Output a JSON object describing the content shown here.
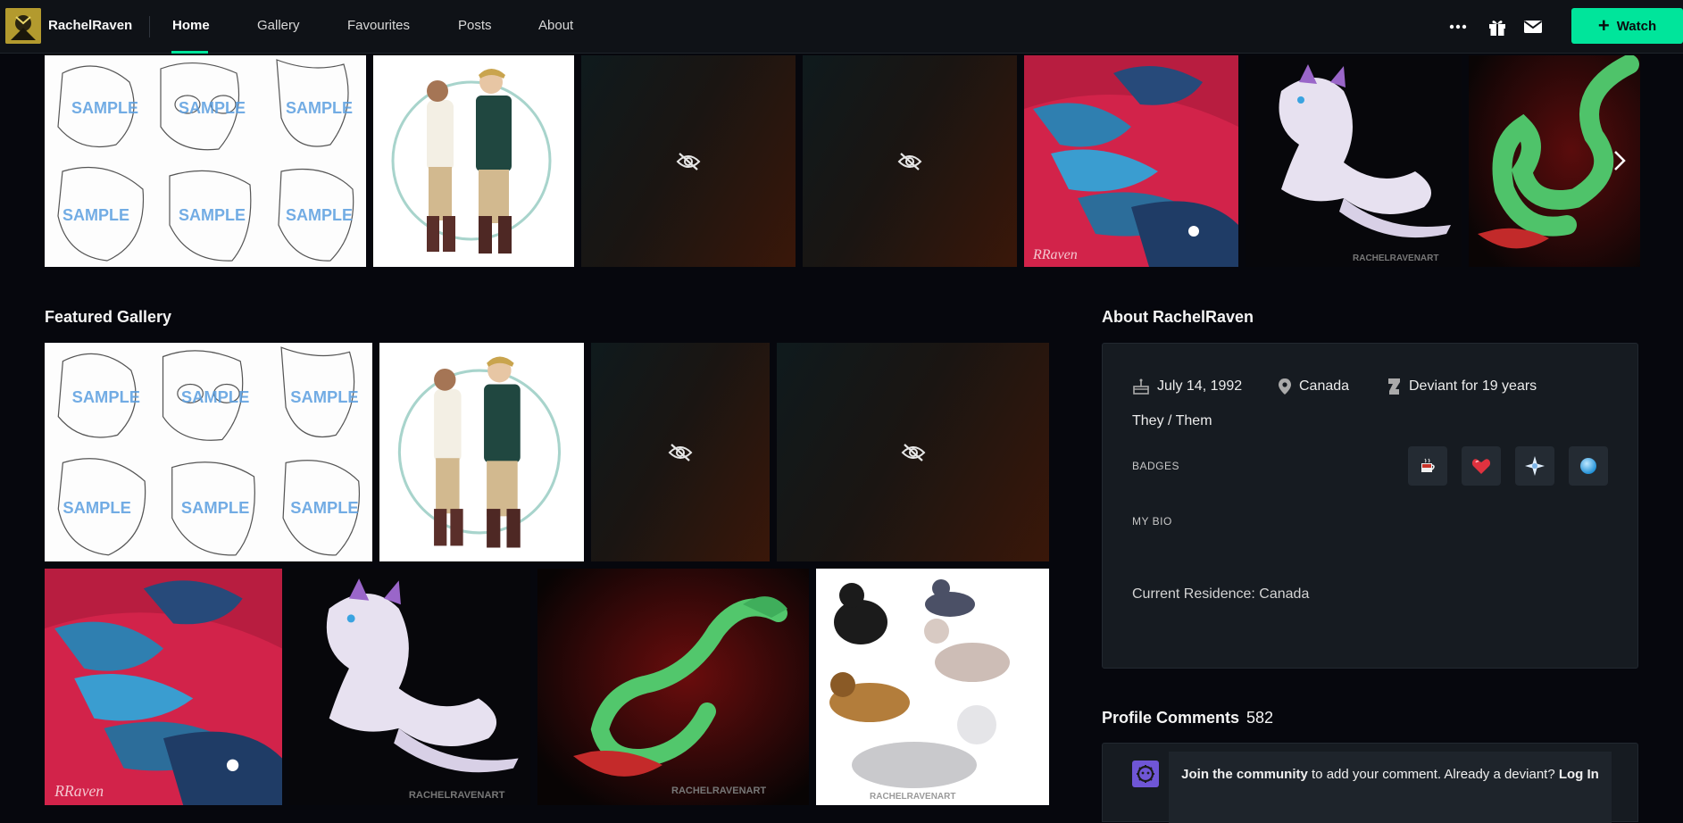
{
  "header": {
    "username": "RachelRaven",
    "tabs": [
      {
        "label": "Home",
        "active": true
      },
      {
        "label": "Gallery",
        "active": false
      },
      {
        "label": "Favourites",
        "active": false
      },
      {
        "label": "Posts",
        "active": false
      },
      {
        "label": "About",
        "active": false
      }
    ],
    "icons": [
      "more-icon",
      "gift-icon",
      "mail-icon"
    ],
    "watch_label": "Watch"
  },
  "featured_gallery": {
    "title": "Featured Gallery"
  },
  "about": {
    "title": "About RachelRaven",
    "birthday": "July 14, 1992",
    "location": "Canada",
    "member_for": "Deviant for 19 years",
    "pronouns": "They / Them",
    "badges_label": "BADGES",
    "badges": [
      "coffee-badge-icon",
      "heart-badge-icon",
      "star-badge-icon",
      "orb-badge-icon"
    ],
    "bio_label": "MY BIO",
    "bio_text": "Current Residence: Canada"
  },
  "comments": {
    "title": "Profile Comments",
    "count": "582",
    "join_bold": "Join the community",
    "join_rest": " to add your comment. Already a deviant? ",
    "login_label": "Log In"
  },
  "watermarks": {
    "sample": "SAMPLE",
    "signature": "RRaven",
    "artist_tag": "RACHELRAVENART"
  },
  "colors": {
    "accent": "#00e59b",
    "background": "#06070d",
    "card": "#161b21"
  }
}
